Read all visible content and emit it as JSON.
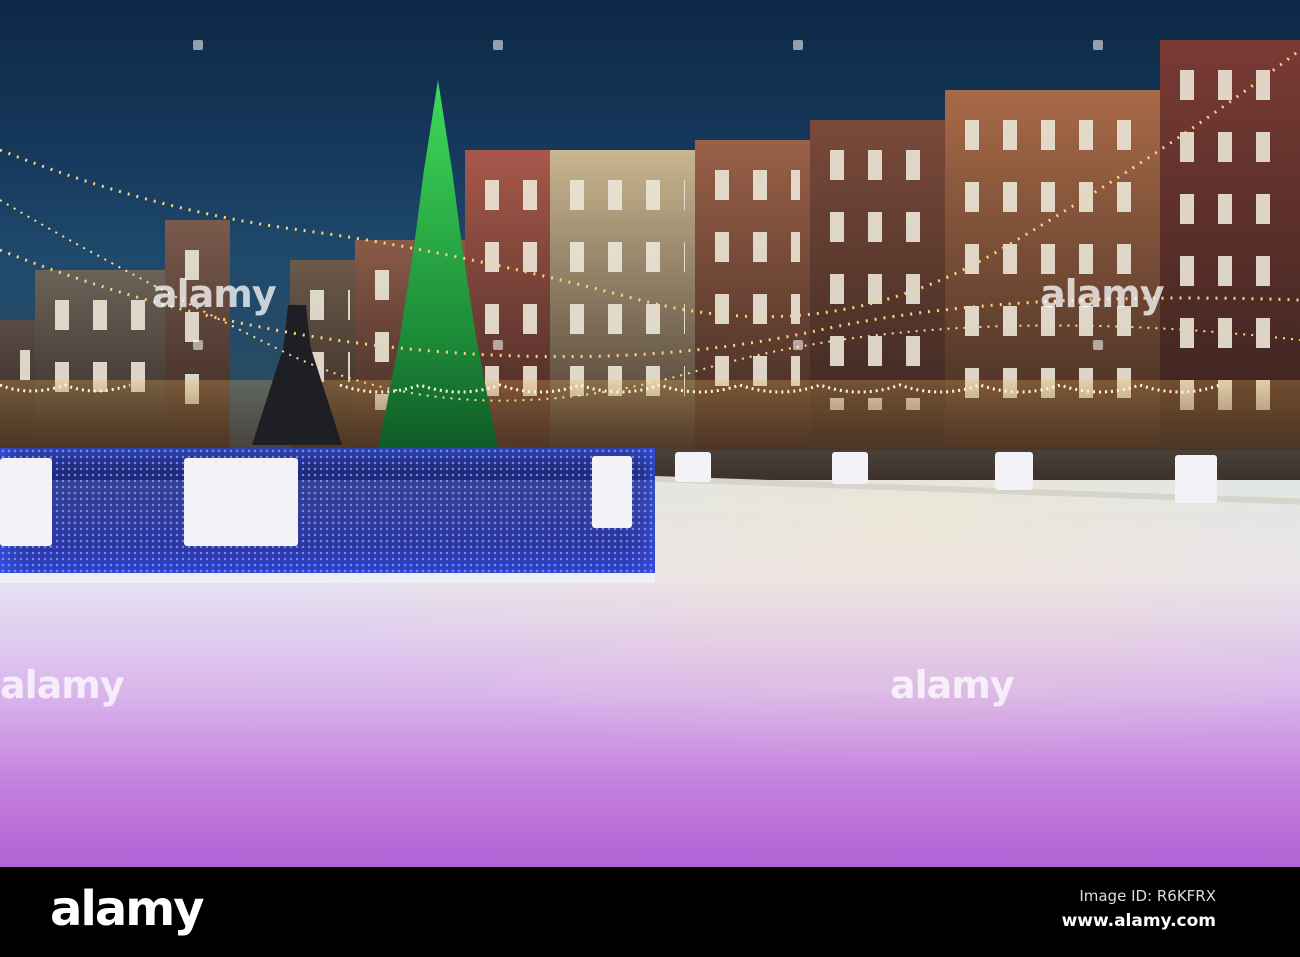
{
  "photo": {
    "watermark": "alamy",
    "colors": {
      "sky": "#16395c",
      "ice_purple": "#c27ddc",
      "tree": "#2fbf4a",
      "fountain": "#2a3cff",
      "lights": "#ffd27a"
    }
  },
  "footer": {
    "logo": "alamy",
    "image_id": "Image ID: R6KFRX",
    "website": "www.alamy.com"
  }
}
